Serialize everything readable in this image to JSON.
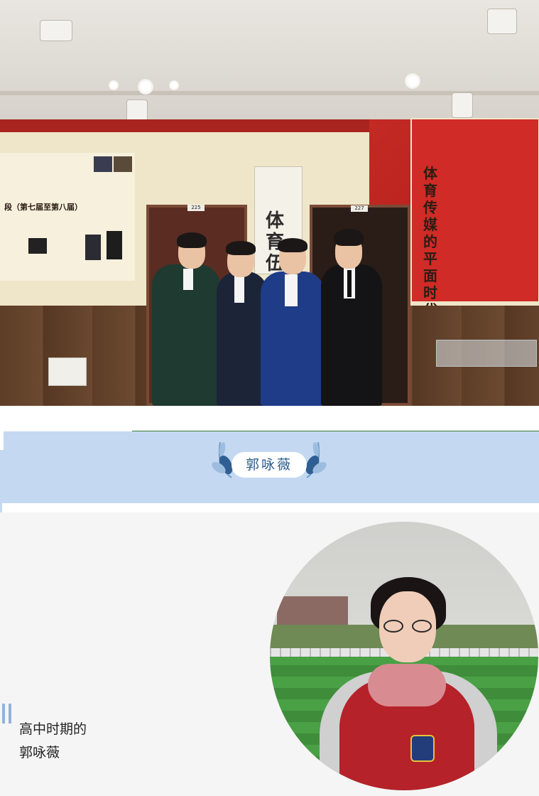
{
  "photo": {
    "poster_text": "体育传媒的平面时代",
    "scroll_text": "体育伍",
    "door_left_number": "225",
    "door_right_number": "227",
    "left_panel_text": "段（第七届至第八届）"
  },
  "section": {
    "title": "郭咏薇"
  },
  "profile": {
    "caption_line1": "高中时期的",
    "caption_line2": "郭咏薇"
  },
  "colors": {
    "title_band": "#c4d9f1",
    "title_text": "#2b5c8f",
    "panel_bg": "#f5f5f5",
    "accent_bars": "#93b3d8"
  },
  "icons": {
    "laurel_left": "laurel-left-icon",
    "laurel_right": "laurel-right-icon",
    "bars": "vertical-bars-icon"
  }
}
